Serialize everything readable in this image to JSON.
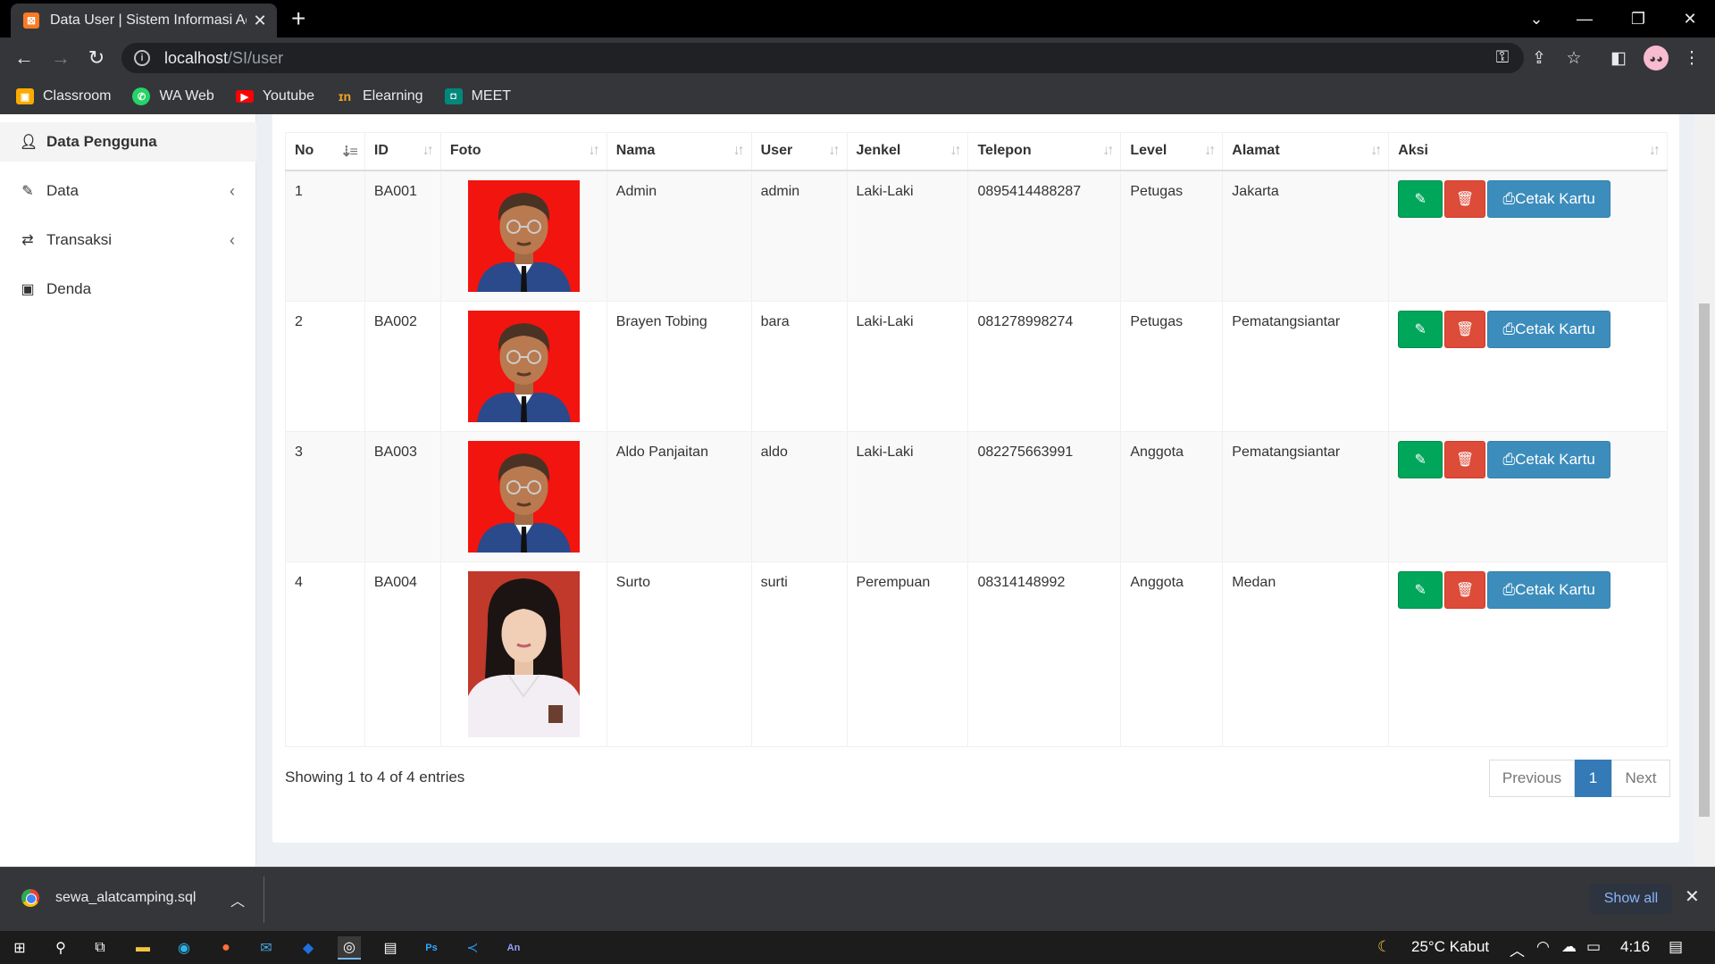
{
  "browser": {
    "tab_title": "Data User | Sistem Informasi Adv",
    "url_host": "localhost",
    "url_path": "/SI/user",
    "bookmarks": [
      "Classroom",
      "WA Web",
      "Youtube",
      "Elearning",
      "MEET"
    ]
  },
  "sidebar": {
    "items": [
      {
        "label": "Data Pengguna",
        "icon": "user-icon"
      },
      {
        "label": "Data",
        "icon": "edit-icon"
      },
      {
        "label": "Transaksi",
        "icon": "exchange-icon"
      },
      {
        "label": "Denda",
        "icon": "money-icon"
      }
    ]
  },
  "table": {
    "columns": [
      "No",
      "ID",
      "Foto",
      "Nama",
      "User",
      "Jenkel",
      "Telepon",
      "Level",
      "Alamat",
      "Aksi"
    ],
    "rows": [
      {
        "no": "1",
        "id": "BA001",
        "nama": "Admin",
        "user": "admin",
        "jenkel": "Laki-Laki",
        "telepon": "0895414488287",
        "level": "Petugas",
        "alamat": "Jakarta"
      },
      {
        "no": "2",
        "id": "BA002",
        "nama": "Brayen Tobing",
        "user": "bara",
        "jenkel": "Laki-Laki",
        "telepon": "081278998274",
        "level": "Petugas",
        "alamat": "Pematangsiantar"
      },
      {
        "no": "3",
        "id": "BA003",
        "nama": "Aldo Panjaitan",
        "user": "aldo",
        "jenkel": "Laki-Laki",
        "telepon": "082275663991",
        "level": "Anggota",
        "alamat": "Pematangsiantar"
      },
      {
        "no": "4",
        "id": "BA004",
        "nama": "Surto",
        "user": "surti",
        "jenkel": "Perempuan",
        "telepon": "08314148992",
        "level": "Anggota",
        "alamat": "Medan"
      }
    ],
    "print_label": "Cetak Kartu"
  },
  "footer": {
    "info": "Showing 1 to 4 of 4 entries",
    "prev": "Previous",
    "page": "1",
    "next": "Next"
  },
  "downloads": {
    "file": "sewa_alatcamping.sql",
    "show_all": "Show all"
  },
  "taskbar": {
    "weather": "25°C  Kabut",
    "time": "4:16"
  },
  "colors": {
    "edit": "#00a65a",
    "delete": "#dd4b39",
    "print": "#3c8dbc",
    "active_page": "#337ab7"
  }
}
